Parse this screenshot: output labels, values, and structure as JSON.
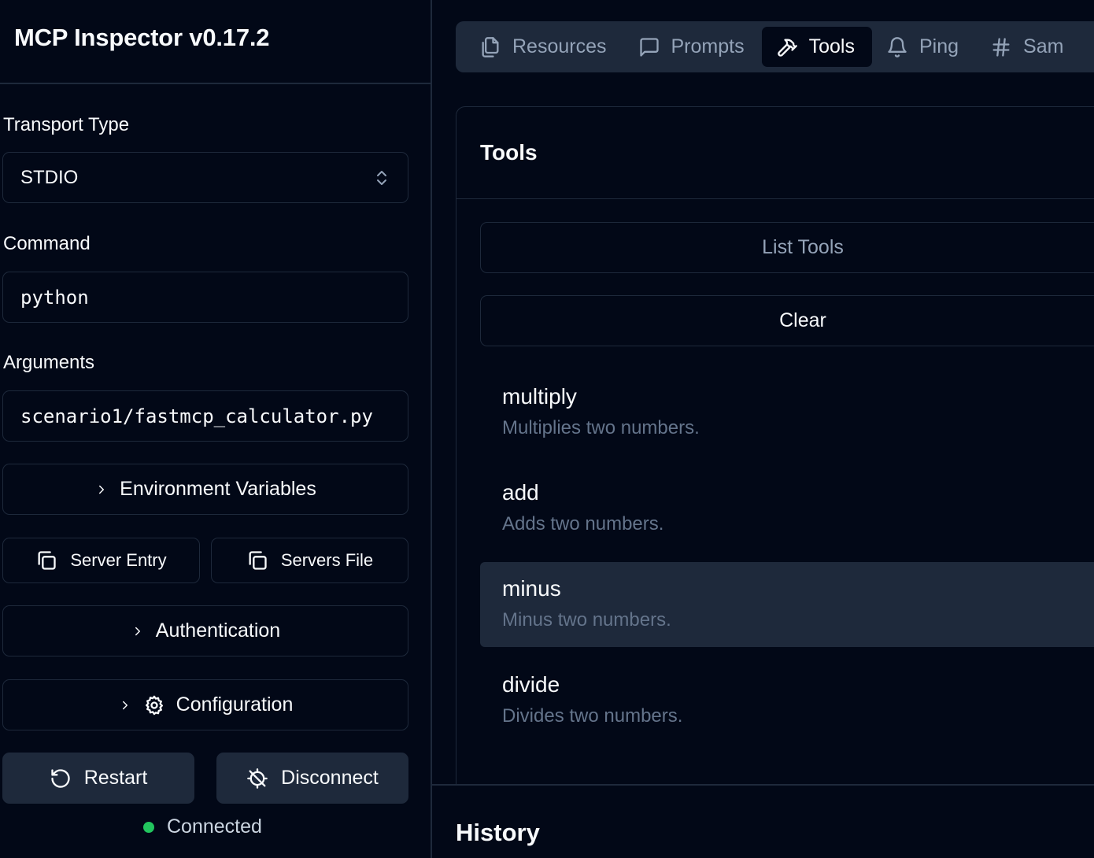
{
  "app": {
    "title": "MCP Inspector v0.17.2"
  },
  "sidebar": {
    "transport_label": "Transport Type",
    "transport_value": "STDIO",
    "command_label": "Command",
    "command_value": "python",
    "arguments_label": "Arguments",
    "arguments_value": "scenario1/fastmcp_calculator.py",
    "env_vars_label": "Environment Variables",
    "server_entry_label": "Server Entry",
    "servers_file_label": "Servers File",
    "authentication_label": "Authentication",
    "configuration_label": "Configuration",
    "restart_label": "Restart",
    "disconnect_label": "Disconnect",
    "status_text": "Connected",
    "status_color": "#22c55e"
  },
  "tabs": [
    {
      "label": "Resources",
      "icon": "files-icon"
    },
    {
      "label": "Prompts",
      "icon": "message-square-icon"
    },
    {
      "label": "Tools",
      "icon": "hammer-icon",
      "active": true
    },
    {
      "label": "Ping",
      "icon": "bell-icon"
    },
    {
      "label": "Sam",
      "icon": "hash-icon"
    }
  ],
  "tools_panel": {
    "title": "Tools",
    "list_button": "List Tools",
    "clear_button": "Clear",
    "items": [
      {
        "name": "multiply",
        "description": "Multiplies two numbers."
      },
      {
        "name": "add",
        "description": "Adds two numbers."
      },
      {
        "name": "minus",
        "description": "Minus two numbers.",
        "selected": true
      },
      {
        "name": "divide",
        "description": "Divides two numbers."
      }
    ]
  },
  "history": {
    "title": "History"
  }
}
